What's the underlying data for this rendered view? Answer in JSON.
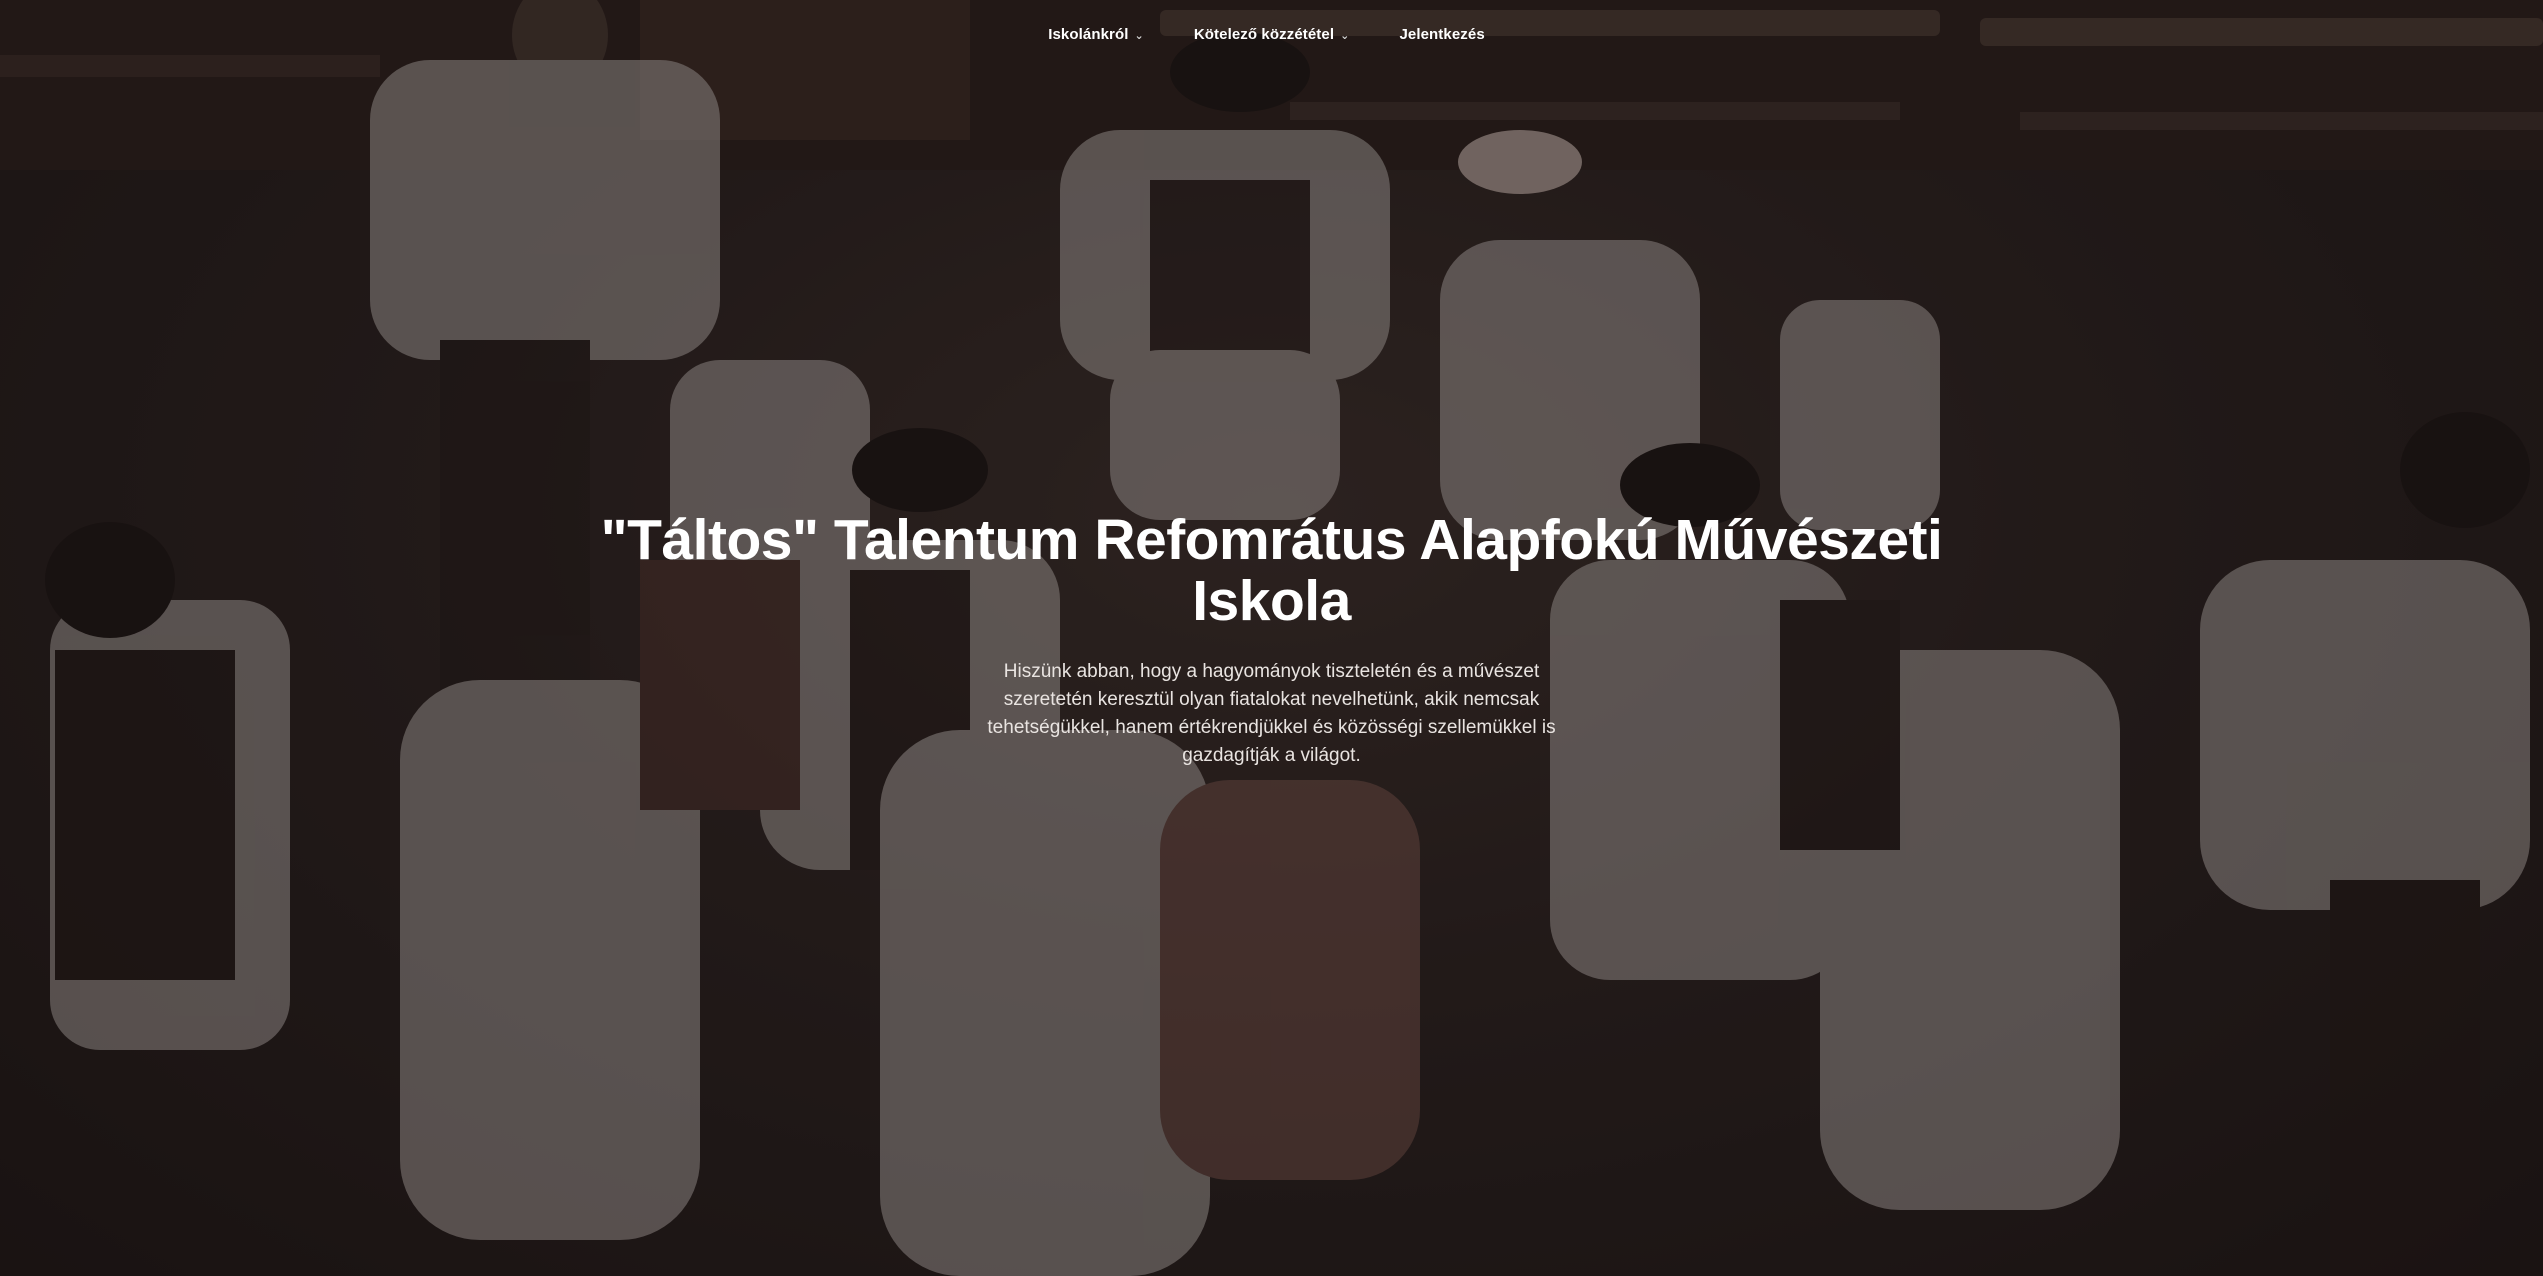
{
  "nav": {
    "items": [
      {
        "label": "Iskolánkról",
        "has_dropdown": true
      },
      {
        "label": "Kötelező közzététel",
        "has_dropdown": true
      },
      {
        "label": "Jelentkezés",
        "has_dropdown": false
      }
    ],
    "dropdown_icon": "chevron-down-icon"
  },
  "hero": {
    "title": "\"Táltos\" Talentum Refomrátus Alapfokú Művészeti Iskola",
    "text": "Hiszünk abban, hogy a hagyományok tiszteletén és a művészet szeretetén keresztül olyan fiatalokat nevelhetünk, akik nemcsak tehetségükkel, hanem értékrendjükkel és közösségi szellemükkel is gazdagítják a világot."
  },
  "colors": {
    "overlay": "#221b19",
    "text": "#ffffff",
    "subtext": "#e9e4e1"
  }
}
